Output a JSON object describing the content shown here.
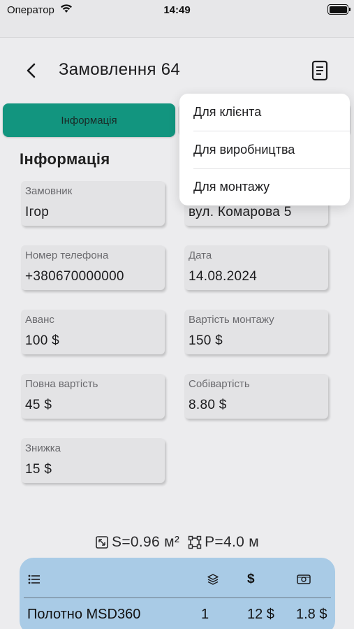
{
  "status": {
    "carrier": "Оператор",
    "time": "14:49"
  },
  "header": {
    "title": "Замовлення 64"
  },
  "tabs": {
    "active_label": "Інформація"
  },
  "section": {
    "title": "Інформація"
  },
  "fields": {
    "customer": {
      "label": "Замовник",
      "value": "Ігор"
    },
    "address": {
      "value": "вул. Комарова 5"
    },
    "phone": {
      "label": "Номер телефона",
      "value": "+380670000000"
    },
    "date": {
      "label": "Дата",
      "value": "14.08.2024"
    },
    "advance": {
      "label": "Аванс",
      "value": "100 $"
    },
    "install_cost": {
      "label": "Вартість монтажу",
      "value": "150 $"
    },
    "full_cost": {
      "label": "Повна вартість",
      "value": "45 $"
    },
    "self_cost": {
      "label": "Собівартість",
      "value": "8.80 $"
    },
    "discount": {
      "label": "Знижка",
      "value": "15 $"
    }
  },
  "menu": {
    "items": [
      "Для клієнта",
      "Для виробництва",
      "Для монтажу"
    ]
  },
  "metrics": {
    "area": "S=0.96 м²",
    "perimeter": "P=4.0 м"
  },
  "table": {
    "header_dollar": "$",
    "rows": [
      {
        "name": "Полотно MSD360",
        "qty": "1",
        "price": "12 $",
        "extra": "1.8 $"
      }
    ]
  },
  "colors": {
    "accent": "#12957f",
    "table_bg": "#a9cbe6",
    "menu_bg": "#ffffff"
  },
  "icons": [
    "wifi-icon",
    "battery-icon",
    "back-chevron-icon",
    "document-icon",
    "list-icon",
    "layers-icon",
    "cash-icon",
    "area-icon",
    "perimeter-icon"
  ]
}
